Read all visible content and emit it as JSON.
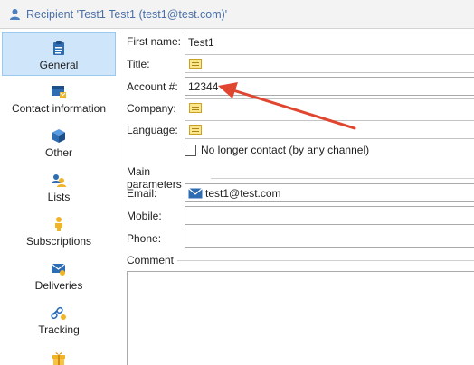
{
  "window": {
    "title": "Recipient 'Test1 Test1 (test1@test.com)'"
  },
  "sidebar": {
    "items": [
      {
        "label": "General",
        "icon": "clipboard-icon",
        "selected": true
      },
      {
        "label": "Contact information",
        "icon": "contact-card-icon"
      },
      {
        "label": "Other",
        "icon": "cube-icon"
      },
      {
        "label": "Lists",
        "icon": "lists-icon"
      },
      {
        "label": "Subscriptions",
        "icon": "subscriptions-icon"
      },
      {
        "label": "Deliveries",
        "icon": "deliveries-icon"
      },
      {
        "label": "Tracking",
        "icon": "tracking-icon"
      },
      {
        "label": "",
        "icon": "gift-icon"
      }
    ]
  },
  "form": {
    "first_name": {
      "label": "First name:",
      "value": "Test1"
    },
    "title": {
      "label": "Title:",
      "value": ""
    },
    "account": {
      "label": "Account #:",
      "value": "12344"
    },
    "company": {
      "label": "Company:",
      "value": ""
    },
    "language": {
      "label": "Language:",
      "value": ""
    },
    "no_longer_contact": {
      "label": "No longer contact (by any channel)",
      "checked": false
    },
    "main_parameters": {
      "title": "Main parameters"
    },
    "email": {
      "label": "Email:",
      "value": "test1@test.com"
    },
    "mobile": {
      "label": "Mobile:",
      "value": ""
    },
    "phone": {
      "label": "Phone:",
      "value": ""
    },
    "comment": {
      "title": "Comment",
      "value": ""
    }
  },
  "annotation": {
    "arrow_color": "#e0452f"
  },
  "colors": {
    "selected_bg": "#cfe5fa",
    "selected_border": "#99c9ef",
    "title_text": "#4a6fa5"
  }
}
